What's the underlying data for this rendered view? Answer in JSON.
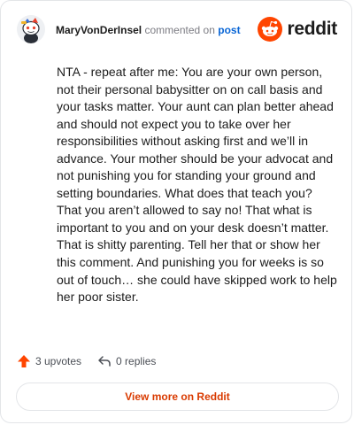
{
  "comment": {
    "author": "MaryVonDerInsel",
    "action_text": "commented on",
    "post_link": "post",
    "body": "NTA - repeat after me: You are your own person, not their personal babysitter on on call basis and your tasks matter. Your aunt can plan better ahead and should not expect you to take over her responsibilities without asking first and we’ll in advance. Your mother should be your advocat and not punishing you for standing your ground and setting boundaries. What does that teach you? That you aren’t allowed to say no! That what is important to you and on your desk doesn’t matter. That is shitty parenting. Tell her that or show her this comment. And punishing you for weeks is so out of touch… she could have skipped work to help her poor sister."
  },
  "brand": {
    "name": "reddit",
    "icon": "reddit-logo-icon",
    "color": "#ff4500"
  },
  "stats": {
    "upvotes_label": "3 upvotes",
    "upvote_icon": "upvote-arrow-icon",
    "upvote_color": "#ff4500",
    "replies_label": "0 replies",
    "reply_icon": "reply-arrow-icon"
  },
  "cta": {
    "label": "View more on Reddit",
    "color": "#d93a00"
  },
  "avatar": {
    "icon": "snoo-avatar-icon"
  }
}
